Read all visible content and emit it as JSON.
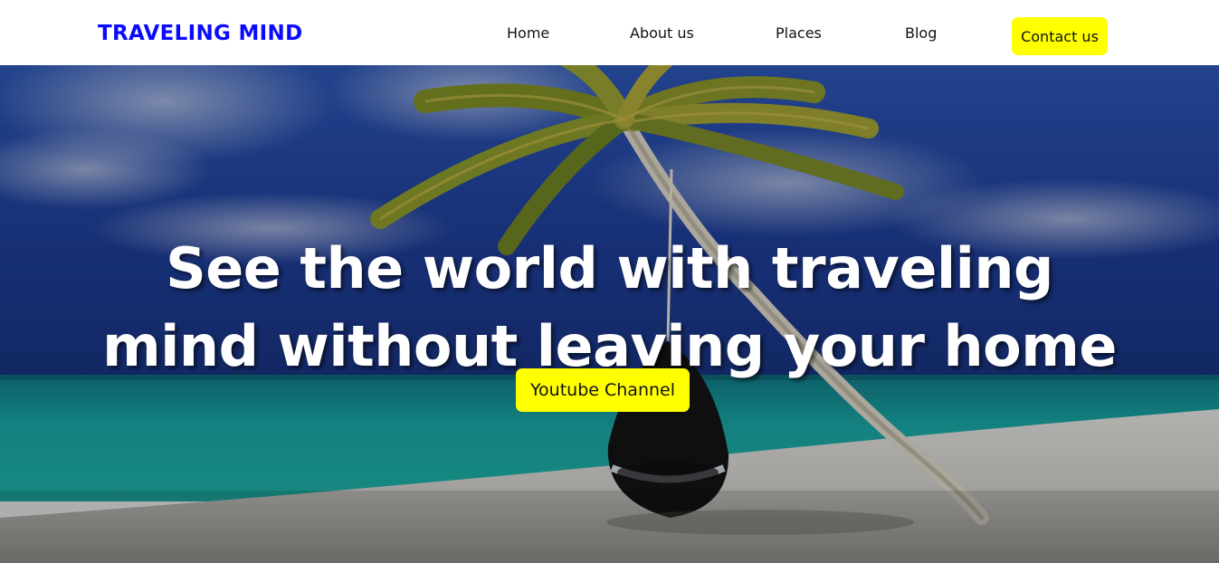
{
  "navbar": {
    "brand": "TRAVELING MIND",
    "links": [
      {
        "label": "Home"
      },
      {
        "label": "About us"
      },
      {
        "label": "Places"
      },
      {
        "label": "Blog"
      }
    ],
    "contact_label": "Contact us"
  },
  "hero": {
    "headline_line1": "See the world with traveling",
    "headline_line2": "mind without leaving your home",
    "cta_label": "Youtube Channel",
    "background_image": "beach-with-palm-tree-and-hanging-swing"
  },
  "colors": {
    "brand": "#0a0aff",
    "button": "#ffff00",
    "sky": "#1f3f9a",
    "sea": "#1aa7a2",
    "sand": "#d9d8d4"
  }
}
